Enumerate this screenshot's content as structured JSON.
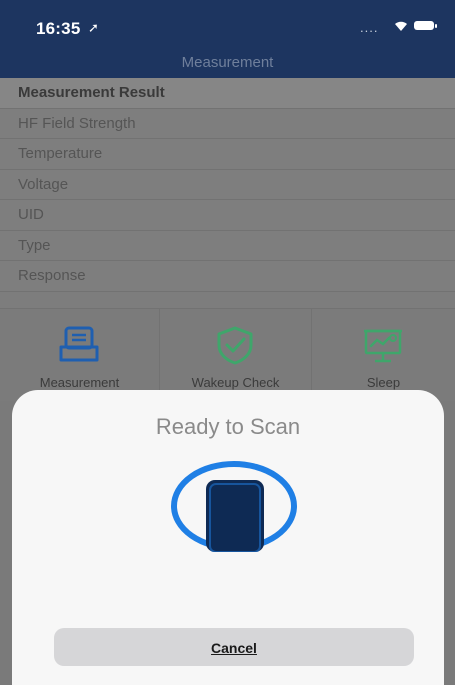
{
  "status": {
    "time": "16:35",
    "signal_dots": "....",
    "location_glyph": "➚"
  },
  "nav": {
    "title": "Measurement"
  },
  "list": {
    "header": "Measurement Result",
    "rows": [
      "HF Field Strength",
      "Temperature",
      "Voltage",
      "UID",
      "Type",
      "Response"
    ]
  },
  "tabs": [
    {
      "label": "Measurement",
      "icon": "measurement-icon"
    },
    {
      "label": "Wakeup Check",
      "icon": "shield-check-icon"
    },
    {
      "label": "Sleep",
      "icon": "sleep-chart-icon"
    }
  ],
  "sheet": {
    "title": "Ready to Scan",
    "cancel": "Cancel"
  },
  "colors": {
    "nav": "#1d3560",
    "accent_blue": "#1f7fe5",
    "phone_fill": "#0e2a54",
    "icon_green": "#3fa66b"
  }
}
